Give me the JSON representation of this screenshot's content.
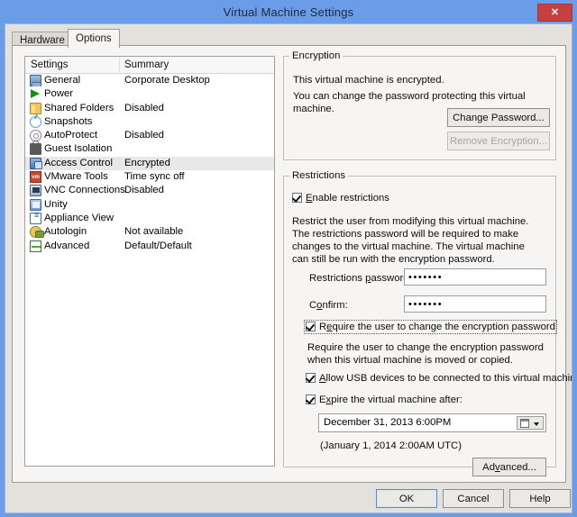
{
  "window": {
    "title": "Virtual Machine Settings",
    "close_label": "✕",
    "titlebar_color": "#6b9ce8",
    "dialog_bg": "#e4e1dd"
  },
  "tabs": [
    {
      "label": "Hardware",
      "active": false
    },
    {
      "label": "Options",
      "active": true
    }
  ],
  "settings_list": {
    "headers": [
      "Settings",
      "Summary"
    ],
    "rows": [
      {
        "icon": "monitor-icon",
        "label": "General",
        "summary": "Corporate Desktop",
        "selected": false
      },
      {
        "icon": "play-icon",
        "label": "Power",
        "summary": "",
        "selected": false
      },
      {
        "icon": "folder-icon",
        "label": "Shared Folders",
        "summary": "Disabled",
        "selected": false
      },
      {
        "icon": "snapshot-icon",
        "label": "Snapshots",
        "summary": "",
        "selected": false
      },
      {
        "icon": "autoprotect-icon",
        "label": "AutoProtect",
        "summary": "Disabled",
        "selected": false
      },
      {
        "icon": "lock-icon",
        "label": "Guest Isolation",
        "summary": "",
        "selected": false
      },
      {
        "icon": "access-icon",
        "label": "Access Control",
        "summary": "Encrypted",
        "selected": true
      },
      {
        "icon": "vmware-tools-icon",
        "label": "VMware Tools",
        "summary": "Time sync off",
        "selected": false
      },
      {
        "icon": "vnc-icon",
        "label": "VNC Connections",
        "summary": "Disabled",
        "selected": false
      },
      {
        "icon": "unity-icon",
        "label": "Unity",
        "summary": "",
        "selected": false
      },
      {
        "icon": "appliance-icon",
        "label": "Appliance View",
        "summary": "",
        "selected": false
      },
      {
        "icon": "autologin-icon",
        "label": "Autologin",
        "summary": "Not available",
        "selected": false
      },
      {
        "icon": "advanced-icon",
        "label": "Advanced",
        "summary": "Default/Default",
        "selected": false
      }
    ]
  },
  "encryption": {
    "legend": "Encryption",
    "line1": "This virtual machine is encrypted.",
    "line2": "You can change the password protecting this virtual machine.",
    "change_password_label": "Change Password...",
    "remove_encryption_label": "Remove Encryption...",
    "remove_encryption_enabled": false
  },
  "restrictions": {
    "legend": "Restrictions",
    "enable_label": "Enable restrictions",
    "enable_checked": true,
    "description": "Restrict the user from modifying this virtual machine. The restrictions password will be required to make changes to the virtual machine. The virtual machine can still be run with the encryption password.",
    "password_label": "Restrictions password:",
    "password_value": "•••••••",
    "confirm_label": "Confirm:",
    "confirm_value": "•••••••",
    "require_change_label": "Require the user to change the encryption password",
    "require_change_checked": true,
    "require_change_focused": true,
    "require_change_help": "Require the user to change the encryption password when this virtual machine is moved or copied.",
    "allow_usb_label": "Allow USB devices to be connected to this virtual machine",
    "allow_usb_checked": true,
    "expire_label": "Expire the virtual machine after:",
    "expire_checked": true,
    "expire_date_value": "December 31, 2013  6:00PM",
    "expire_utc_note": "(January 1, 2014 2:00AM UTC)",
    "advanced_label": "Advanced..."
  },
  "footer": {
    "ok_label": "OK",
    "cancel_label": "Cancel",
    "help_label": "Help"
  }
}
